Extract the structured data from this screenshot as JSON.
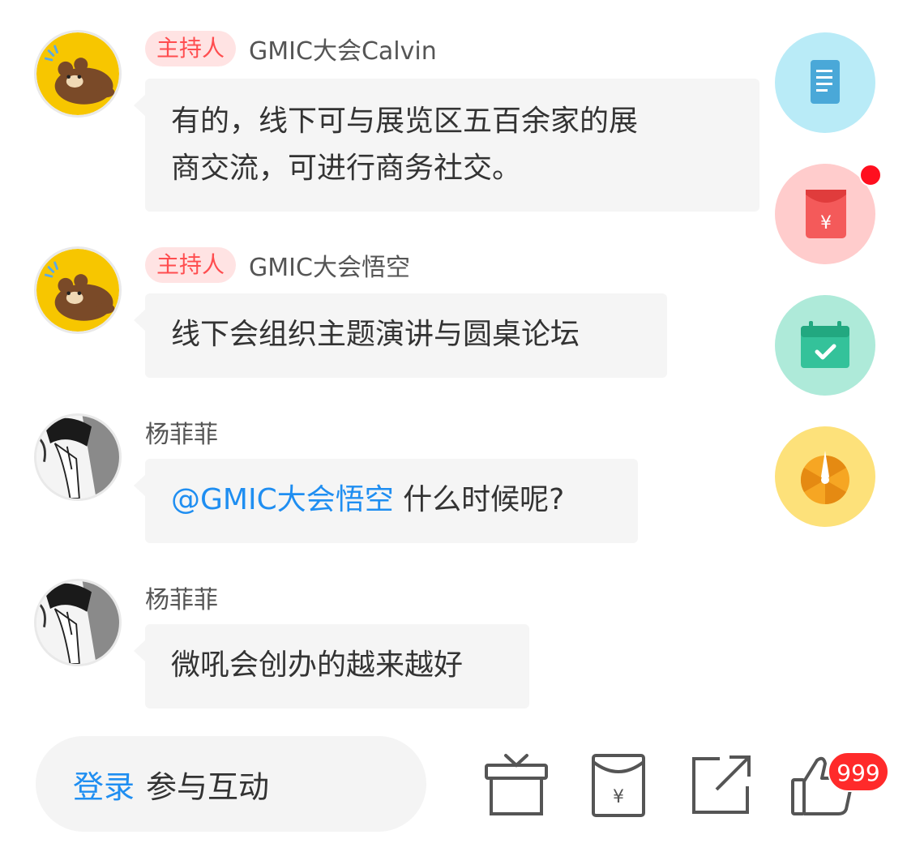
{
  "messages": [
    {
      "badge": "主持人",
      "user": "GMIC大会Calvin",
      "lines": [
        "有的，线下可与展览区五百余家的展",
        "商交流，可进行商务社交。"
      ],
      "avatar": "bear-avatar"
    },
    {
      "badge": "主持人",
      "user": "GMIC大会悟空",
      "text": "线下会组织主题演讲与圆桌论坛",
      "avatar": "bear-avatar"
    },
    {
      "user": "杨菲菲",
      "mention": "@GMIC大会悟空",
      "text": " 什么时候呢?",
      "avatar": "manga-avatar"
    },
    {
      "user": "杨菲菲",
      "text": "微吼会创办的越来越好",
      "avatar": "manga-avatar"
    }
  ],
  "side_buttons": [
    {
      "icon": "document-icon",
      "bg": "#b9ebf7"
    },
    {
      "icon": "red-envelope-icon",
      "bg": "#ffcccc",
      "has_dot": true
    },
    {
      "icon": "calendar-check-icon",
      "bg": "#aeead9"
    },
    {
      "icon": "lottery-wheel-icon",
      "bg": "#fde17a"
    }
  ],
  "bottom_bar": {
    "login_link": "登录",
    "login_text": "参与互动",
    "tools": [
      "gift-icon",
      "red-envelope-outline-icon",
      "share-icon",
      "like-icon"
    ],
    "like_count": "999"
  },
  "colors": {
    "accent_blue": "#1f8ef1",
    "badge_red": "#ff4d4f",
    "bubble_bg": "#f5f5f5"
  }
}
